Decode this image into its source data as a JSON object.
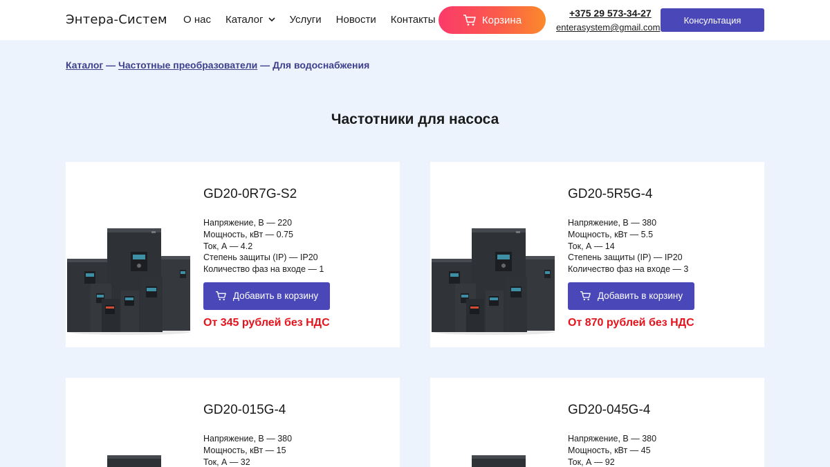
{
  "header": {
    "logo": "Энтера-Систем",
    "nav": [
      "О нас",
      "Каталог",
      "Услуги",
      "Новости",
      "Контакты"
    ],
    "cart_label": "Корзина",
    "phone": "+375 29 573-34-27",
    "email": "enterasystem@gmail.com",
    "consult_label": "Консультация"
  },
  "breadcrumb": {
    "items": [
      "Каталог",
      "Частотные преобразователи",
      "Для водоснабжения"
    ],
    "separator": " — "
  },
  "page_title": "Частотники для насоса",
  "colors": {
    "accent": "#4a48b8",
    "price": "#e4131b",
    "cart_gradient_start": "#fb3a6a",
    "cart_gradient_end": "#fb8a2a",
    "background": "#edf3fd"
  },
  "products": [
    {
      "title": "GD20-0R7G-S2",
      "specs": [
        "Напряжение, В — 220",
        "Мощность, кВт — 0.75",
        "Ток, А — 4.2",
        "Степень защиты (IP) — IP20",
        "Количество фаз на входе — 1"
      ],
      "add_label": "Добавить в корзину",
      "price": "От 345 рублей без НДС"
    },
    {
      "title": "GD20-5R5G-4",
      "specs": [
        "Напряжение, В — 380",
        "Мощность, кВт — 5.5",
        "Ток, А — 14",
        "Степень защиты (IP) — IP20",
        "Количество фаз на входе — 3"
      ],
      "add_label": "Добавить в корзину",
      "price": "От 870 рублей без НДС"
    },
    {
      "title": "GD20-015G-4",
      "specs": [
        "Напряжение, В — 380",
        "Мощность, кВт — 15",
        "Ток, А — 32"
      ],
      "add_label": "",
      "price": ""
    },
    {
      "title": "GD20-045G-4",
      "specs": [
        "Напряжение, В — 380",
        "Мощность, кВт — 45",
        "Ток, А — 92"
      ],
      "add_label": "",
      "price": ""
    }
  ],
  "icons": {
    "cart": "cart-icon",
    "chevron": "chevron-down-icon",
    "product_image": "frequency-drive-image"
  }
}
